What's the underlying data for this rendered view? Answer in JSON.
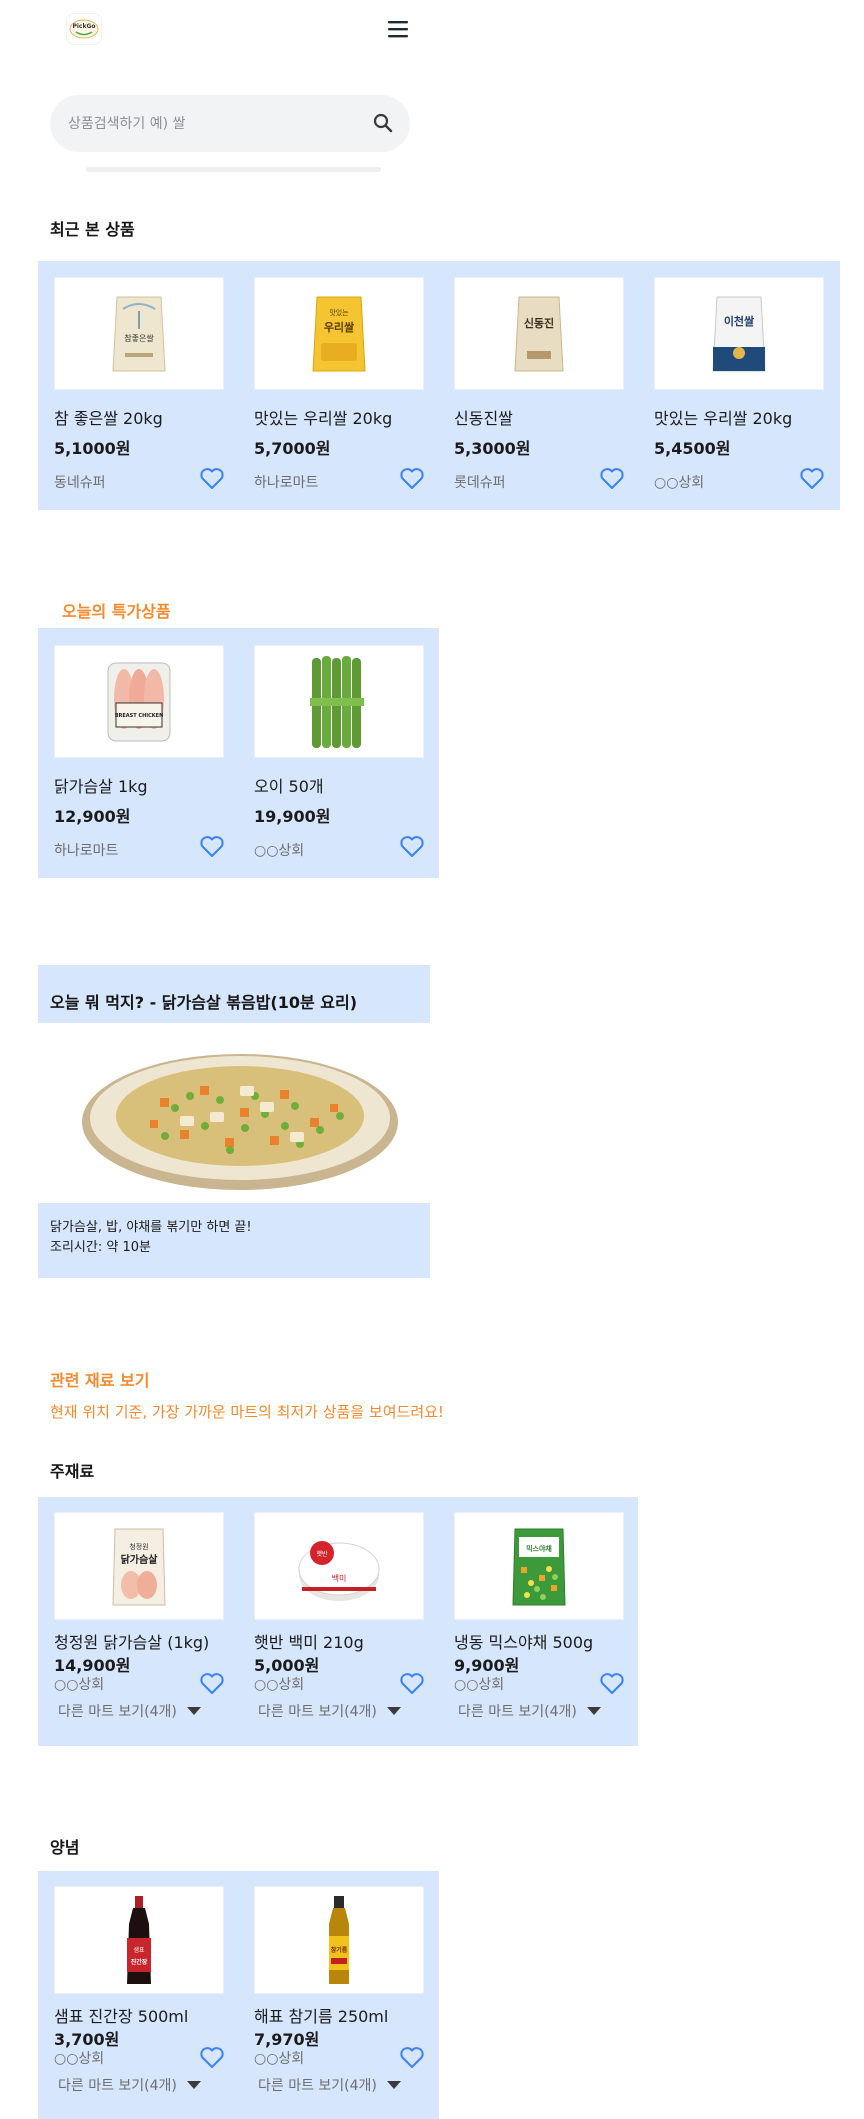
{
  "header": {
    "logo_text": "PickGo"
  },
  "search": {
    "placeholder": "상품검색하기 예) 쌀"
  },
  "recent": {
    "title": "최근 본 상품",
    "items": [
      {
        "name": "참 좋은쌀 20kg",
        "price": "5,1000원",
        "store": "동네슈퍼",
        "label": "참좋은쌀"
      },
      {
        "name": "맛있는 우리쌀 20kg",
        "price": "5,7000원",
        "store": "하나로마트",
        "label": "우리쌀"
      },
      {
        "name": "신동진쌀",
        "price": "5,3000원",
        "store": "롯데슈퍼",
        "label": "신동진"
      },
      {
        "name": "맛있는 우리쌀 20kg",
        "price": "5,4500원",
        "store": "○○상회",
        "label": "이천쌀"
      }
    ]
  },
  "special": {
    "title": "오늘의 특가상품",
    "items": [
      {
        "name": "닭가슴살 1kg",
        "price": "12,900원",
        "store": "하나로마트",
        "label": "BREAST CHICKEN"
      },
      {
        "name": "오이 50개",
        "price": "19,900원",
        "store": "○○상회"
      }
    ]
  },
  "recipe": {
    "title": "오늘 뭐 먹지? - 닭가슴살 볶음밥(10분 요리)",
    "desc_line1": "닭가슴살, 밥, 야채를 볶기만 하면 끝!",
    "desc_line2": "조리시간: 약 10분"
  },
  "related": {
    "title": "관련 재료 보기",
    "subtitle": "현재 위치 기준, 가장 가까운 마트의 최저가 상품을 보여드려요!"
  },
  "main_ingredients": {
    "title": "주재료",
    "items": [
      {
        "name": "청정원 닭가슴살 (1kg)",
        "price": "14,900원",
        "store": "○○상회",
        "more": "다른 마트 보기(4개)",
        "label": "닭가슴살"
      },
      {
        "name": "햇반 백미 210g",
        "price": "5,000원",
        "store": "○○상회",
        "more": "다른 마트 보기(4개)",
        "label": "백미"
      },
      {
        "name": "냉동 믹스야채 500g",
        "price": "9,900원",
        "store": "○○상회",
        "more": "다른 마트 보기(4개)",
        "label": "믹스야채"
      }
    ]
  },
  "seasoning": {
    "title": "양념",
    "items": [
      {
        "name": "샘표 진간장 500ml",
        "price": "3,700원",
        "store": "○○상회",
        "more": "다른 마트 보기(4개)",
        "label": "진간장"
      },
      {
        "name": "해표 참기름 250ml",
        "price": "7,970원",
        "store": "○○상회",
        "more": "다른 마트 보기(4개)",
        "label": "참기름"
      }
    ]
  },
  "colors": {
    "panel": "#d6e6fd",
    "accent": "#f58a2e",
    "heart": "#3b82f6"
  }
}
